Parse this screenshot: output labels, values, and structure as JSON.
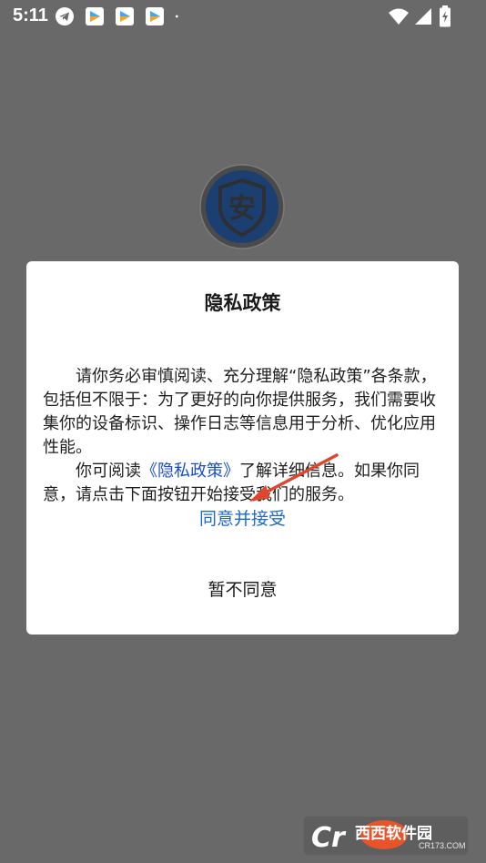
{
  "status_bar": {
    "time": "5:11",
    "icons_left": [
      "telegram-icon",
      "app-notification-icon",
      "app-notification-icon",
      "app-notification-icon",
      "dot-icon"
    ],
    "icons_right": [
      "wifi-icon",
      "signal-icon",
      "battery-charging-icon"
    ]
  },
  "app": {
    "logo_icon": "shield-an-icon",
    "logo_glyph": "安"
  },
  "dialog": {
    "title": "隐私政策",
    "paragraph1": "请你务必审慎阅读、充分理解“隐私政策”各条款，包括但不限于：为了更好的向你提供服务，我们需要收集你的设备标识、操作日志等信息用于分析、优化应用性能。",
    "paragraph2_prefix": "你可阅读",
    "paragraph2_link": "《隐私政策》",
    "paragraph2_suffix": "了解详细信息。如果你同意，请点击下面按钮开始接受我们的服务。",
    "accept_label": "同意并接受",
    "decline_label": "暂不同意"
  },
  "watermark": {
    "brand": "西西软件园",
    "url": "CR173.COM"
  },
  "colors": {
    "background": "#696969",
    "link": "#1a4fc5",
    "accept": "#2169c9",
    "arrow": "#e0452d"
  }
}
